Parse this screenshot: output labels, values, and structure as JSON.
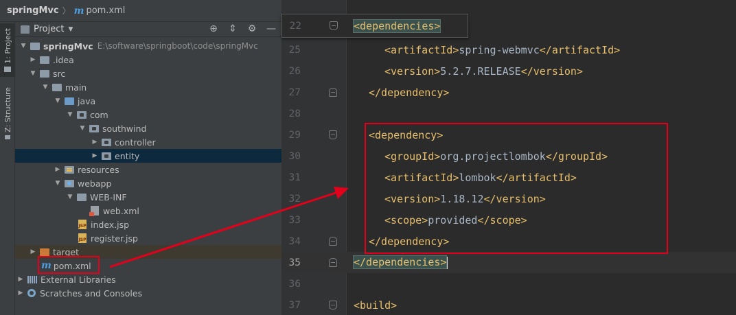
{
  "breadcrumb": {
    "project": "springMvc",
    "file": "pom.xml",
    "file_icon": "m"
  },
  "tool_stripe": {
    "project_tab": "1: Project",
    "structure_tab": "Z: Structure"
  },
  "panel": {
    "title": "Project"
  },
  "tree": [
    {
      "label": "springMvc",
      "path": "E:\\software\\springboot\\code\\springMvc",
      "arrow": "▼",
      "icon": "folder"
    },
    {
      "label": ".idea",
      "arrow": "▶",
      "icon": "folder"
    },
    {
      "label": "src",
      "arrow": "▼",
      "icon": "folder"
    },
    {
      "label": "main",
      "arrow": "▼",
      "icon": "folder"
    },
    {
      "label": "java",
      "arrow": "▼",
      "icon": "source-folder"
    },
    {
      "label": "com",
      "arrow": "▼",
      "icon": "package"
    },
    {
      "label": "southwind",
      "arrow": "▼",
      "icon": "package"
    },
    {
      "label": "controller",
      "arrow": "▶",
      "icon": "package"
    },
    {
      "label": "entity",
      "arrow": "▶",
      "icon": "package"
    },
    {
      "label": "resources",
      "arrow": "▶",
      "icon": "resources-folder"
    },
    {
      "label": "webapp",
      "arrow": "▼",
      "icon": "web-folder"
    },
    {
      "label": "WEB-INF",
      "arrow": "▼",
      "icon": "folder"
    },
    {
      "label": "web.xml",
      "arrow": "",
      "icon": "xml-file"
    },
    {
      "label": "index.jsp",
      "arrow": "",
      "icon": "jsp-file"
    },
    {
      "label": "register.jsp",
      "arrow": "",
      "icon": "jsp-file"
    },
    {
      "label": "target",
      "arrow": "▶",
      "icon": "excluded-folder"
    },
    {
      "label": "pom.xml",
      "arrow": "",
      "icon": "maven-file"
    },
    {
      "label": "External Libraries",
      "arrow": "▶",
      "icon": "libraries"
    },
    {
      "label": "Scratches and Consoles",
      "arrow": "▶",
      "icon": "scratches"
    }
  ],
  "jsp_badge": "JSP",
  "editor": {
    "sticky": {
      "num": "22",
      "code": "<dependencies>"
    },
    "lines": [
      {
        "num": "25",
        "tag_open": "<artifactId>",
        "text": "spring-webmvc",
        "tag_close": "</artifactId>"
      },
      {
        "num": "26",
        "tag_open": "<version>",
        "text": "5.2.7.RELEASE",
        "tag_close": "</version>"
      },
      {
        "num": "27",
        "tag_open": "</dependency>",
        "text": "",
        "tag_close": ""
      },
      {
        "num": "28",
        "tag_open": "",
        "text": "",
        "tag_close": ""
      },
      {
        "num": "29",
        "tag_open": "<dependency>",
        "text": "",
        "tag_close": ""
      },
      {
        "num": "30",
        "tag_open": "<groupId>",
        "text": "org.projectlombok",
        "tag_close": "</groupId>"
      },
      {
        "num": "31",
        "tag_open": "<artifactId>",
        "text": "lombok",
        "tag_close": "</artifactId>"
      },
      {
        "num": "32",
        "tag_open": "<version>",
        "text": "1.18.12",
        "tag_close": "</version>"
      },
      {
        "num": "33",
        "tag_open": "<scope>",
        "text": "provided",
        "tag_close": "</scope>"
      },
      {
        "num": "34",
        "tag_open": "</dependency>",
        "text": "",
        "tag_close": ""
      },
      {
        "num": "35",
        "tag_open": "</dependencies>",
        "text": "",
        "tag_close": ""
      },
      {
        "num": "36",
        "tag_open": "",
        "text": "",
        "tag_close": ""
      },
      {
        "num": "37",
        "tag_open": "<build>",
        "text": "",
        "tag_close": ""
      }
    ]
  },
  "colors": {
    "annotation_red": "#e3001b",
    "xml_tag": "#e8bf6a",
    "xml_text": "#a9b7c6",
    "selection": "#0d293e"
  }
}
